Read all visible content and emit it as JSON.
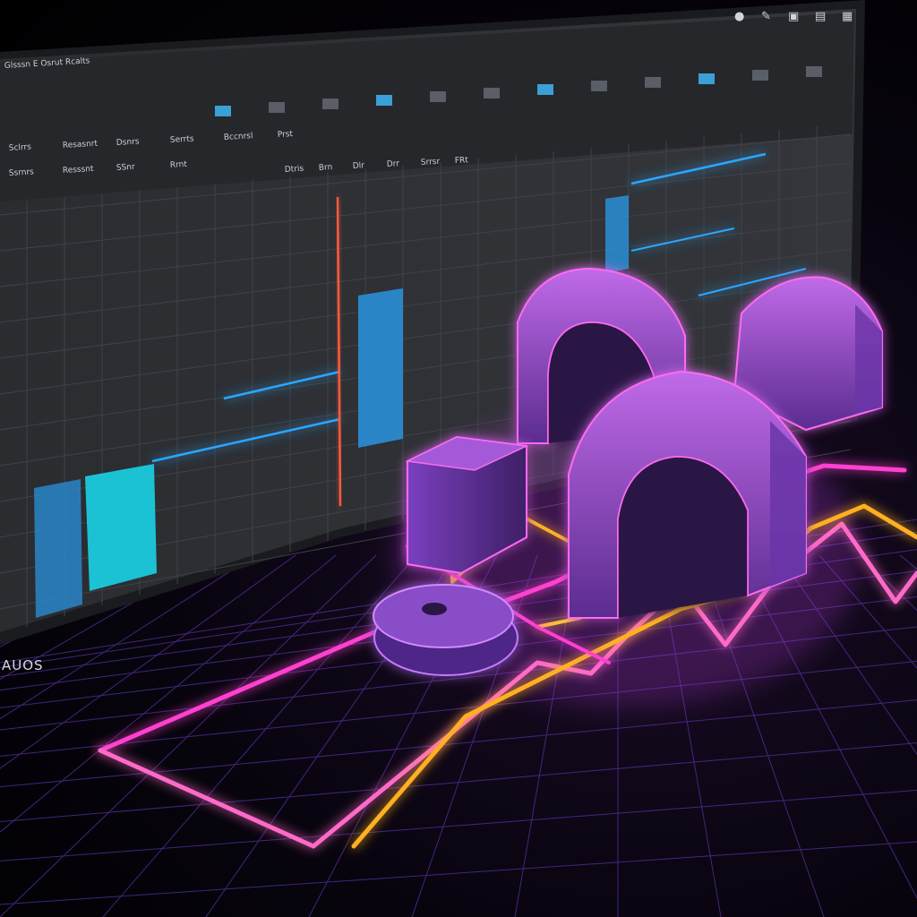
{
  "monitor": {
    "toolbar": {
      "left_title": "Glsssn E Osrut Rcalts",
      "row1_labels": [
        "Sclrrs",
        "Resasnrt",
        "Dsnrs",
        "Serrts",
        "Bccnrsl",
        "Prst"
      ],
      "row2_labels": [
        "Ssrnrs",
        "Resssnt",
        "SSnr",
        "Rrnt"
      ],
      "tab_labels": [
        "Dtris",
        "Brn",
        "Dlr",
        "Drr",
        "Srrsr",
        "FRt"
      ],
      "top_right_icons": [
        "lightbulb-icon",
        "wand-icon",
        "image-icon",
        "layers-icon",
        "grid-icon"
      ]
    },
    "colors": {
      "panel": "#2b2d31",
      "grid": "#3b3e44",
      "cyan": "#19d3e6",
      "blue": "#2a8fd6",
      "accent_line": "#2aa7ff",
      "marker": "#ff5a3c"
    }
  },
  "corner_label": "AUOS",
  "neon": {
    "pink": "#ff3fd0",
    "orange": "#ffb020",
    "purple": "#8b4fd8"
  }
}
